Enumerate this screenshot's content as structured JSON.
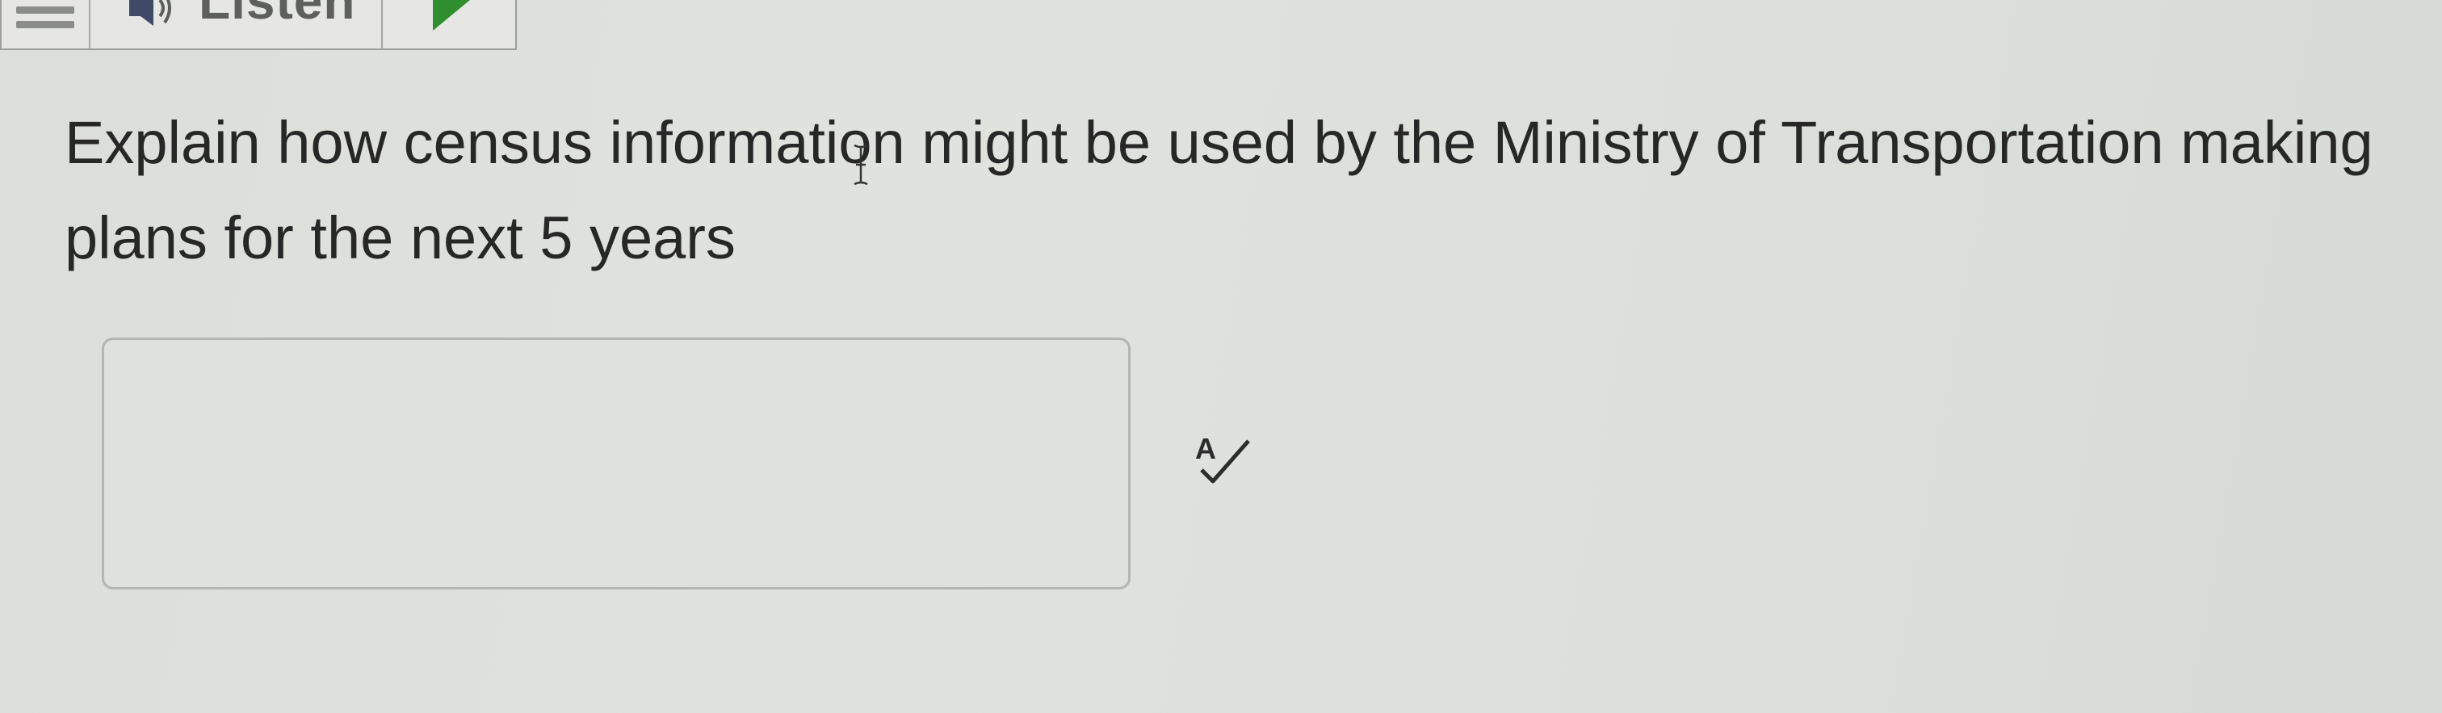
{
  "toolbar": {
    "menu_icon": "hamburger-menu-icon",
    "listen_icon": "speaker-icon",
    "listen_label": "Listen",
    "play_icon": "play-icon",
    "play_color": "#2f8f2f"
  },
  "question": {
    "text": "Explain how census information might be used by the Ministry of Transportation making plans for the next 5 years"
  },
  "answer": {
    "value": "",
    "placeholder": ""
  },
  "spell_check": {
    "icon": "spell-check-icon",
    "label": "A"
  }
}
